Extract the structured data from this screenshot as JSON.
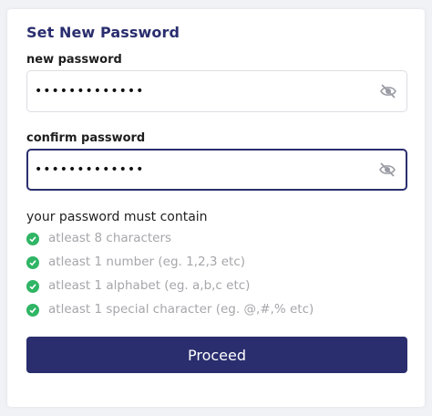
{
  "form": {
    "title": "Set New Password",
    "new_password": {
      "label": "new password",
      "value": "•••••••••••••"
    },
    "confirm_password": {
      "label": "confirm password",
      "value": "•••••••••••••"
    },
    "requirements_title": "your password must contain",
    "requirements": [
      {
        "text": "atleast 8 characters",
        "met": true
      },
      {
        "text": "atleast 1 number (eg. 1,2,3 etc)",
        "met": true
      },
      {
        "text": "atleast 1 alphabet (eg. a,b,c etc)",
        "met": true
      },
      {
        "text": "atleast 1 special character (eg. @,#,% etc)",
        "met": true
      }
    ],
    "submit_label": "Proceed"
  },
  "icons": {
    "visibility_toggle": "eye-slash-icon",
    "requirement_status": "check-circle-icon"
  },
  "colors": {
    "primary": "#2a2e6e",
    "success": "#2fb565",
    "muted_text": "#a6a6ab"
  }
}
